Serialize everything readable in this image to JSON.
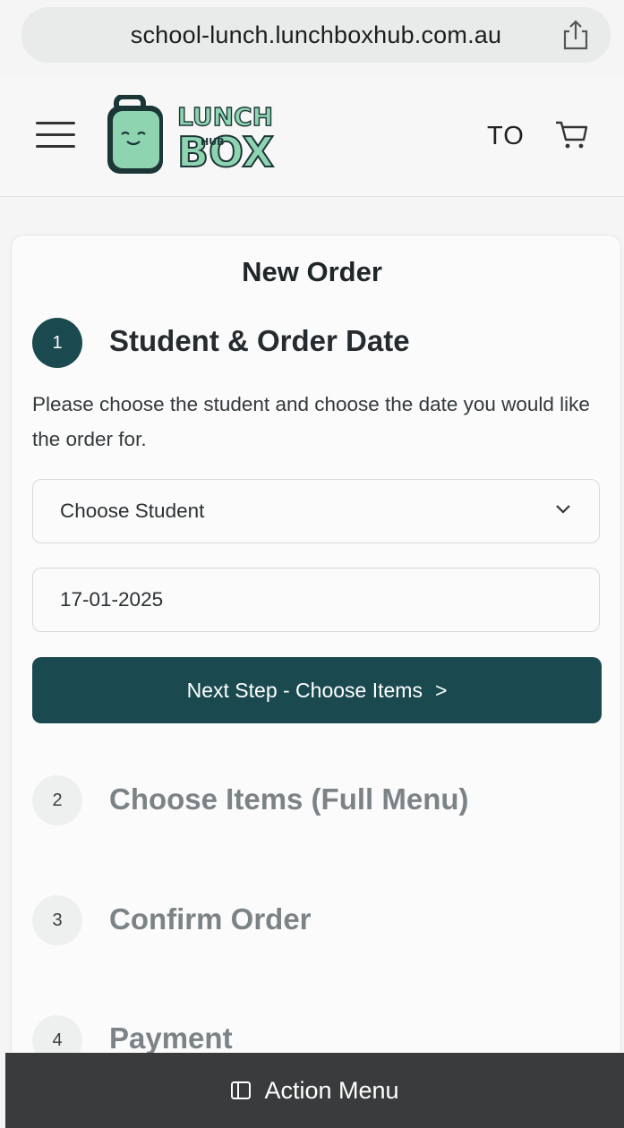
{
  "browser": {
    "url": "school-lunch.lunchboxhub.com.au"
  },
  "header": {
    "logo": {
      "line1": "LUNCH",
      "line2": "BOX",
      "badge": "HUB"
    },
    "user_initials": "TO"
  },
  "main": {
    "title": "New Order",
    "steps": [
      {
        "number": "1",
        "title": "Student & Order Date",
        "active": true
      },
      {
        "number": "2",
        "title": "Choose Items (Full Menu)",
        "active": false
      },
      {
        "number": "3",
        "title": "Confirm Order",
        "active": false
      },
      {
        "number": "4",
        "title": "Payment",
        "active": false
      }
    ],
    "instructions": "Please choose the student and choose the date you would like the order for.",
    "student_select": {
      "selected": "Choose Student"
    },
    "date_field": {
      "value": "17-01-2025"
    },
    "next_button": {
      "label": "Next Step - Choose Items",
      "chevron": ">"
    }
  },
  "footer": {
    "action_menu_label": "Action Menu"
  },
  "colors": {
    "primary": "#1a4a50",
    "logo_green": "#8fd4b0",
    "logo_dark": "#1c3638"
  }
}
